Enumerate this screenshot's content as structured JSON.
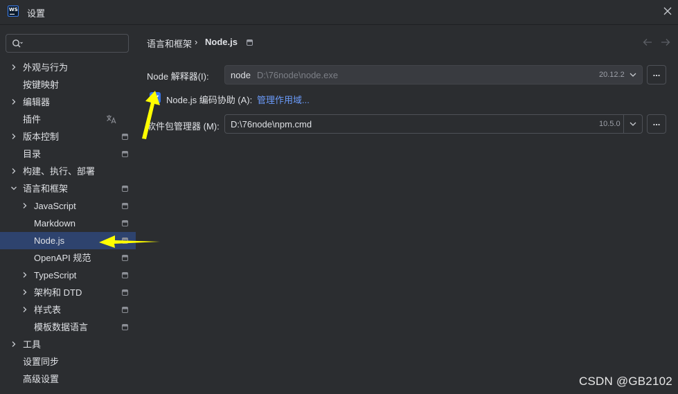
{
  "window": {
    "title": "设置",
    "logo_text": "WS"
  },
  "search": {
    "placeholder": ""
  },
  "sidebar": {
    "items": [
      {
        "label": "外观与行为",
        "expandable": true,
        "expanded": false,
        "level": 0,
        "project": false
      },
      {
        "label": "按键映射",
        "expandable": false,
        "level": 0,
        "project": false
      },
      {
        "label": "编辑器",
        "expandable": true,
        "expanded": false,
        "level": 0,
        "project": false
      },
      {
        "label": "插件",
        "expandable": false,
        "level": 0,
        "project": false,
        "translate_icon": true
      },
      {
        "label": "版本控制",
        "expandable": true,
        "expanded": false,
        "level": 0,
        "project": true
      },
      {
        "label": "目录",
        "expandable": false,
        "level": 0,
        "project": true
      },
      {
        "label": "构建、执行、部署",
        "expandable": true,
        "expanded": false,
        "level": 0,
        "project": false
      },
      {
        "label": "语言和框架",
        "expandable": true,
        "expanded": true,
        "level": 0,
        "project": true
      },
      {
        "label": "JavaScript",
        "expandable": true,
        "expanded": false,
        "level": 1,
        "project": true
      },
      {
        "label": "Markdown",
        "expandable": false,
        "level": 1,
        "project": true
      },
      {
        "label": "Node.js",
        "expandable": false,
        "level": 1,
        "project": true,
        "selected": true
      },
      {
        "label": "OpenAPI 规范",
        "expandable": false,
        "level": 1,
        "project": true
      },
      {
        "label": "TypeScript",
        "expandable": true,
        "expanded": false,
        "level": 1,
        "project": true
      },
      {
        "label": "架构和 DTD",
        "expandable": true,
        "expanded": false,
        "level": 1,
        "project": true
      },
      {
        "label": "样式表",
        "expandable": true,
        "expanded": false,
        "level": 1,
        "project": true
      },
      {
        "label": "模板数据语言",
        "expandable": false,
        "level": 1,
        "project": true
      },
      {
        "label": "工具",
        "expandable": true,
        "expanded": false,
        "level": 0,
        "project": false
      },
      {
        "label": "设置同步",
        "expandable": false,
        "level": 0,
        "project": false
      },
      {
        "label": "高级设置",
        "expandable": false,
        "level": 0,
        "project": false
      }
    ]
  },
  "breadcrumb": {
    "parent": "语言和框架",
    "separator": "›",
    "current": "Node.js"
  },
  "node_interpreter": {
    "label": "Node 解释器(I):",
    "name": "node",
    "path": "D:\\76node\\node.exe",
    "version": "20.12.2",
    "browse_label": "..."
  },
  "coding_assistance": {
    "checked": true,
    "label": "Node.js 编码协助 (A):",
    "link": "管理作用域..."
  },
  "package_manager": {
    "label": "软件包管理器 (M):",
    "value": "D:\\76node\\npm.cmd",
    "version": "10.5.0",
    "browse_label": "..."
  },
  "annotation": {
    "color": "#ffff00"
  },
  "watermark": "CSDN @GB2102",
  "colors": {
    "background": "#2b2d30",
    "selection": "#2e436e",
    "accent": "#3574f0",
    "link": "#6b9bfa"
  }
}
